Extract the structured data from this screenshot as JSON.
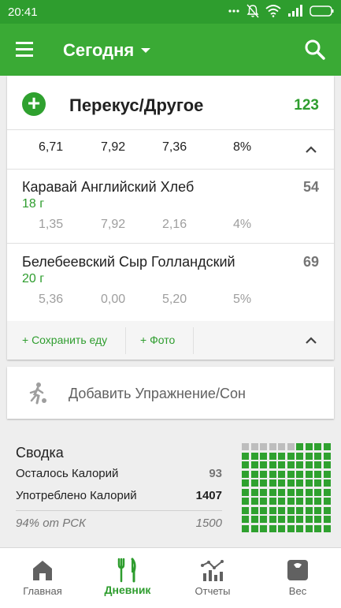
{
  "status": {
    "time": "20:41"
  },
  "appbar": {
    "title": "Сегодня"
  },
  "meal": {
    "title": "Перекус/Другое",
    "calories": "123",
    "summary": [
      "6,71",
      "7,92",
      "7,36",
      "8%"
    ],
    "items": [
      {
        "name": "Каравай Английский Хлеб",
        "qty": "18  г",
        "calories": "54",
        "macros": [
          "1,35",
          "7,92",
          "2,16",
          "4%"
        ]
      },
      {
        "name": "Белебеевский Сыр Голландский",
        "qty": "20  г",
        "calories": "69",
        "macros": [
          "5,36",
          "0,00",
          "5,20",
          "5%"
        ]
      }
    ],
    "save_label": "+ Сохранить еду",
    "photo_label": "+ Фото"
  },
  "exercise": {
    "label": "Добавить Упражнение/Сон"
  },
  "summary": {
    "title": "Сводка",
    "remaining_label": "Осталось Калорий",
    "remaining_value": "93",
    "consumed_label": "Употреблено Калорий",
    "consumed_value": "1407",
    "rsk_label": "94% от РСК",
    "rsk_value": "1500",
    "progress_fraction": 0.94
  },
  "tabs": [
    {
      "label": "Главная",
      "icon": "home-icon",
      "active": false
    },
    {
      "label": "Дневник",
      "icon": "diary-icon",
      "active": true
    },
    {
      "label": "Отчеты",
      "icon": "reports-icon",
      "active": false
    },
    {
      "label": "Вес",
      "icon": "scale-icon",
      "active": false
    }
  ],
  "colors": {
    "accent": "#3aaa35",
    "accent_dark": "#2e9d2e",
    "grid_filled": "#2fa12f",
    "grid_empty": "#bdbdbd"
  }
}
